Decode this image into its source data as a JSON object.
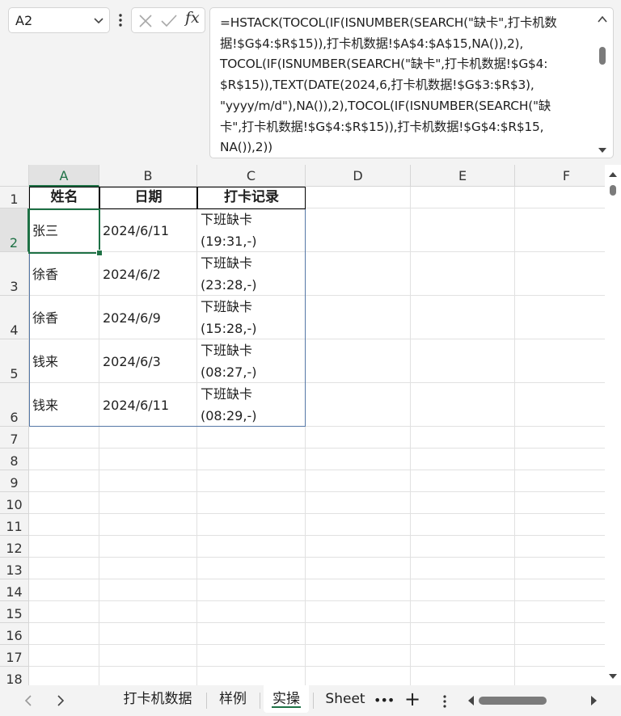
{
  "name_box": {
    "value": "A2"
  },
  "formula_bar": {
    "fx_label": "fx",
    "formula_lines": [
      "=HSTACK(TOCOL(IF(ISNUMBER(SEARCH(\"缺卡\",打卡机数",
      "据!$G$4:$R$15)),打卡机数据!$A$4:$A$15,NA()),2),",
      "TOCOL(IF(ISNUMBER(SEARCH(\"缺卡\",打卡机数据!$G$4:",
      "$R$15)),TEXT(DATE(2024,6,打卡机数据!$G$3:$R$3),",
      "\"yyyy/m/d\"),NA()),2),TOCOL(IF(ISNUMBER(SEARCH(\"缺",
      "卡\",打卡机数据!$G$4:$R$15)),打卡机数据!$G$4:$R$15,",
      "NA()),2))"
    ]
  },
  "columns": [
    "A",
    "B",
    "C",
    "D",
    "E",
    "F"
  ],
  "rows": [
    "1",
    "2",
    "3",
    "4",
    "5",
    "6",
    "7",
    "8",
    "9",
    "10",
    "11",
    "12",
    "13",
    "14",
    "15",
    "16",
    "17",
    "18"
  ],
  "table": {
    "headers": [
      "姓名",
      "日期",
      "打卡记录"
    ],
    "records": [
      [
        "张三",
        "2024/6/11",
        "下班缺卡\n(19:31,-)"
      ],
      [
        "徐香",
        "2024/6/2",
        "下班缺卡\n(23:28,-)"
      ],
      [
        "徐香",
        "2024/6/9",
        "下班缺卡\n(15:28,-)"
      ],
      [
        "钱来",
        "2024/6/3",
        "下班缺卡\n(08:27,-)"
      ],
      [
        "钱来",
        "2024/6/11",
        "下班缺卡\n(08:29,-)"
      ]
    ]
  },
  "sheet_tabs": {
    "tabs": [
      "打卡机数据",
      "样例",
      "实操",
      "Sheet"
    ],
    "active": "实操",
    "more_label": "•••",
    "add_label": "+"
  },
  "colors": {
    "accent": "#1e7145",
    "table_border": "#5577a6"
  }
}
